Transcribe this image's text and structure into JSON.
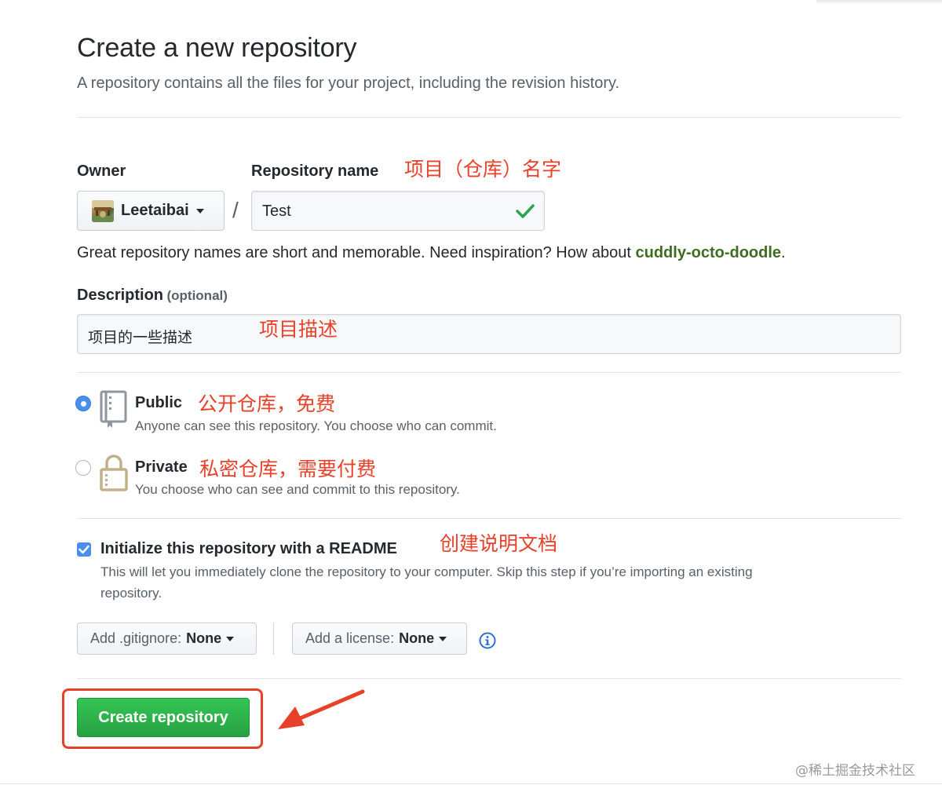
{
  "header": {
    "title": "Create a new repository",
    "subtitle": "A repository contains all the files for your project, including the revision history."
  },
  "owner": {
    "label": "Owner",
    "name": "Leetaibai"
  },
  "repo": {
    "label": "Repository name",
    "separator": "/",
    "value": "Test",
    "annotation": "项目（仓库）名字",
    "hint_prefix": "Great repository names are short and memorable. Need inspiration? How about ",
    "hint_suggestion": "cuddly-octo-doodle",
    "hint_suffix": "."
  },
  "description": {
    "label": "Description",
    "optional": "(optional)",
    "value": "项目的一些描述",
    "annotation": "项目描述"
  },
  "visibility": {
    "public": {
      "title": "Public",
      "annotation": "公开仓库，免费",
      "desc": "Anyone can see this repository. You choose who can commit.",
      "selected": true
    },
    "private": {
      "title": "Private",
      "annotation": "私密仓库，需要付费",
      "desc": "You choose who can see and commit to this repository.",
      "selected": false
    }
  },
  "readme": {
    "label": "Initialize this repository with a README",
    "annotation": "创建说明文档",
    "desc_line1": "This will let you immediately clone the repository to your computer. Skip this step if you’re importing an existing",
    "desc_line2": "repository.",
    "checked": true
  },
  "gitignore": {
    "label": "Add .gitignore:",
    "value": "None"
  },
  "license": {
    "label": "Add a license:",
    "value": "None"
  },
  "submit": {
    "label": "Create repository"
  },
  "watermark": "@稀土掘金技术社区",
  "colors": {
    "accent": "#4a8ef0",
    "primary": "#2ea44f",
    "annotation": "#e8412a",
    "suggestion": "#3d6d1f"
  }
}
